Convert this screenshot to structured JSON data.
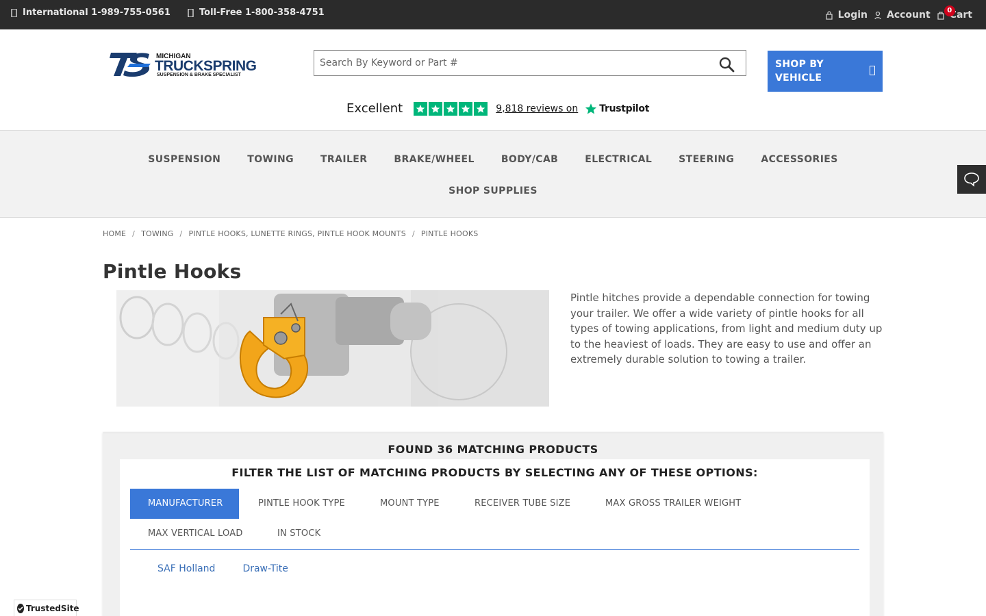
{
  "topbar": {
    "international": "International 1-989-755-0561",
    "tollfree": "Toll-Free 1-800-358-4751",
    "login": "Login",
    "account": "Account",
    "cart": "Cart",
    "cart_count": "0"
  },
  "header": {
    "logo": {
      "small": "MICHIGAN",
      "big": "TRUCKSPRING",
      "tagline": "SUSPENSION & BRAKE SPECIALIST"
    },
    "search_placeholder": "Search By Keyword or Part #",
    "shop_by_vehicle": "SHOP BY VEHICLE",
    "trustpilot": {
      "rating_word": "Excellent",
      "stars": 5,
      "reviews": "9,818 reviews on",
      "brand": "Trustpilot"
    }
  },
  "nav": {
    "items": [
      "SUSPENSION",
      "TOWING",
      "TRAILER",
      "BRAKE/WHEEL",
      "BODY/CAB",
      "ELECTRICAL",
      "STEERING",
      "ACCESSORIES"
    ],
    "row2": "SHOP SUPPLIES"
  },
  "breadcrumb": [
    "HOME",
    "TOWING",
    "PINTLE HOOKS, LUNETTE RINGS, PINTLE HOOK MOUNTS",
    "PINTLE HOOKS"
  ],
  "page": {
    "title": "Pintle Hooks",
    "description": "Pintle hitches provide a dependable connection for towing your trailer. We offer a wide variety of pintle hooks for all types of towing applications, from light and medium duty up to the heaviest of loads. They are easy to use and offer an extremely durable solution to towing a trailer."
  },
  "products": {
    "found": "FOUND 36 MATCHING PRODUCTS",
    "filter_title": "FILTER THE LIST OF MATCHING PRODUCTS BY SELECTING ANY OF THESE OPTIONS:",
    "tabs": [
      "MANUFACTURER",
      "PINTLE HOOK TYPE",
      "MOUNT TYPE",
      "RECEIVER TUBE SIZE",
      "MAX GROSS TRAILER WEIGHT",
      "MAX VERTICAL LOAD",
      "IN STOCK"
    ],
    "active_tab": "MANUFACTURER",
    "options": [
      "SAF Holland",
      "Draw-Tite"
    ]
  },
  "trusted_site": "TrustedSite",
  "colors": {
    "topbar": "#2b2b2b",
    "accent": "#3a78d8",
    "trustpilot_green": "#00b67a",
    "badge_red": "#d0021b"
  }
}
